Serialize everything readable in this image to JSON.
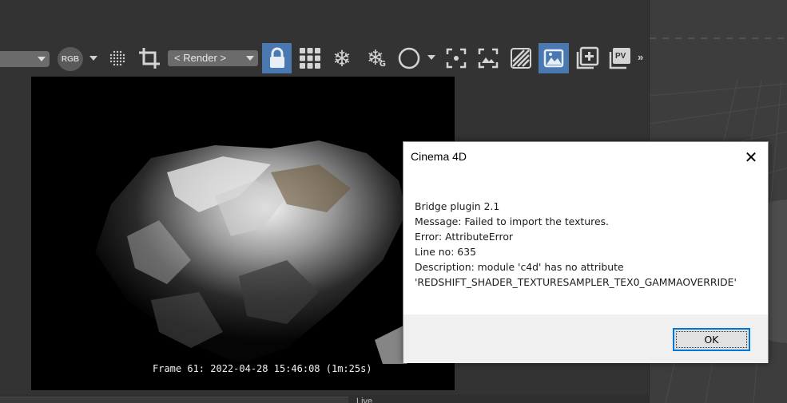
{
  "toolbar": {
    "color_channel_label": "RGB",
    "render_select_value": "< Render >",
    "pv_label": "PV",
    "more_label": "»",
    "icons": [
      "dropdown",
      "rgb-channel",
      "dither",
      "crop",
      "render-select",
      "lock",
      "grid",
      "snowflake",
      "snowflake-g",
      "circle",
      "region",
      "image-fit",
      "stripes",
      "image-compare",
      "add-snapshot",
      "pv"
    ]
  },
  "viewport": {
    "frame_info": "Frame  61:  2022-04-28  15:46:08  (1m:25s)"
  },
  "status": {
    "live_label": "Live"
  },
  "dialog": {
    "title": "Cinema 4D",
    "close_glyph": "✕",
    "lines": [
      "Bridge plugin 2.1",
      "Message: Failed to import the textures.",
      "Error: AttributeError",
      "Line no: 635",
      "Description: module 'c4d' has no attribute",
      "'REDSHIFT_SHADER_TEXTURESAMPLER_TEX0_GAMMAOVERRIDE'"
    ],
    "ok_label": "OK"
  },
  "colors": {
    "app_bg": "#333333",
    "active_toggle": "#4a78b0",
    "dialog_focus": "#0078d7"
  }
}
